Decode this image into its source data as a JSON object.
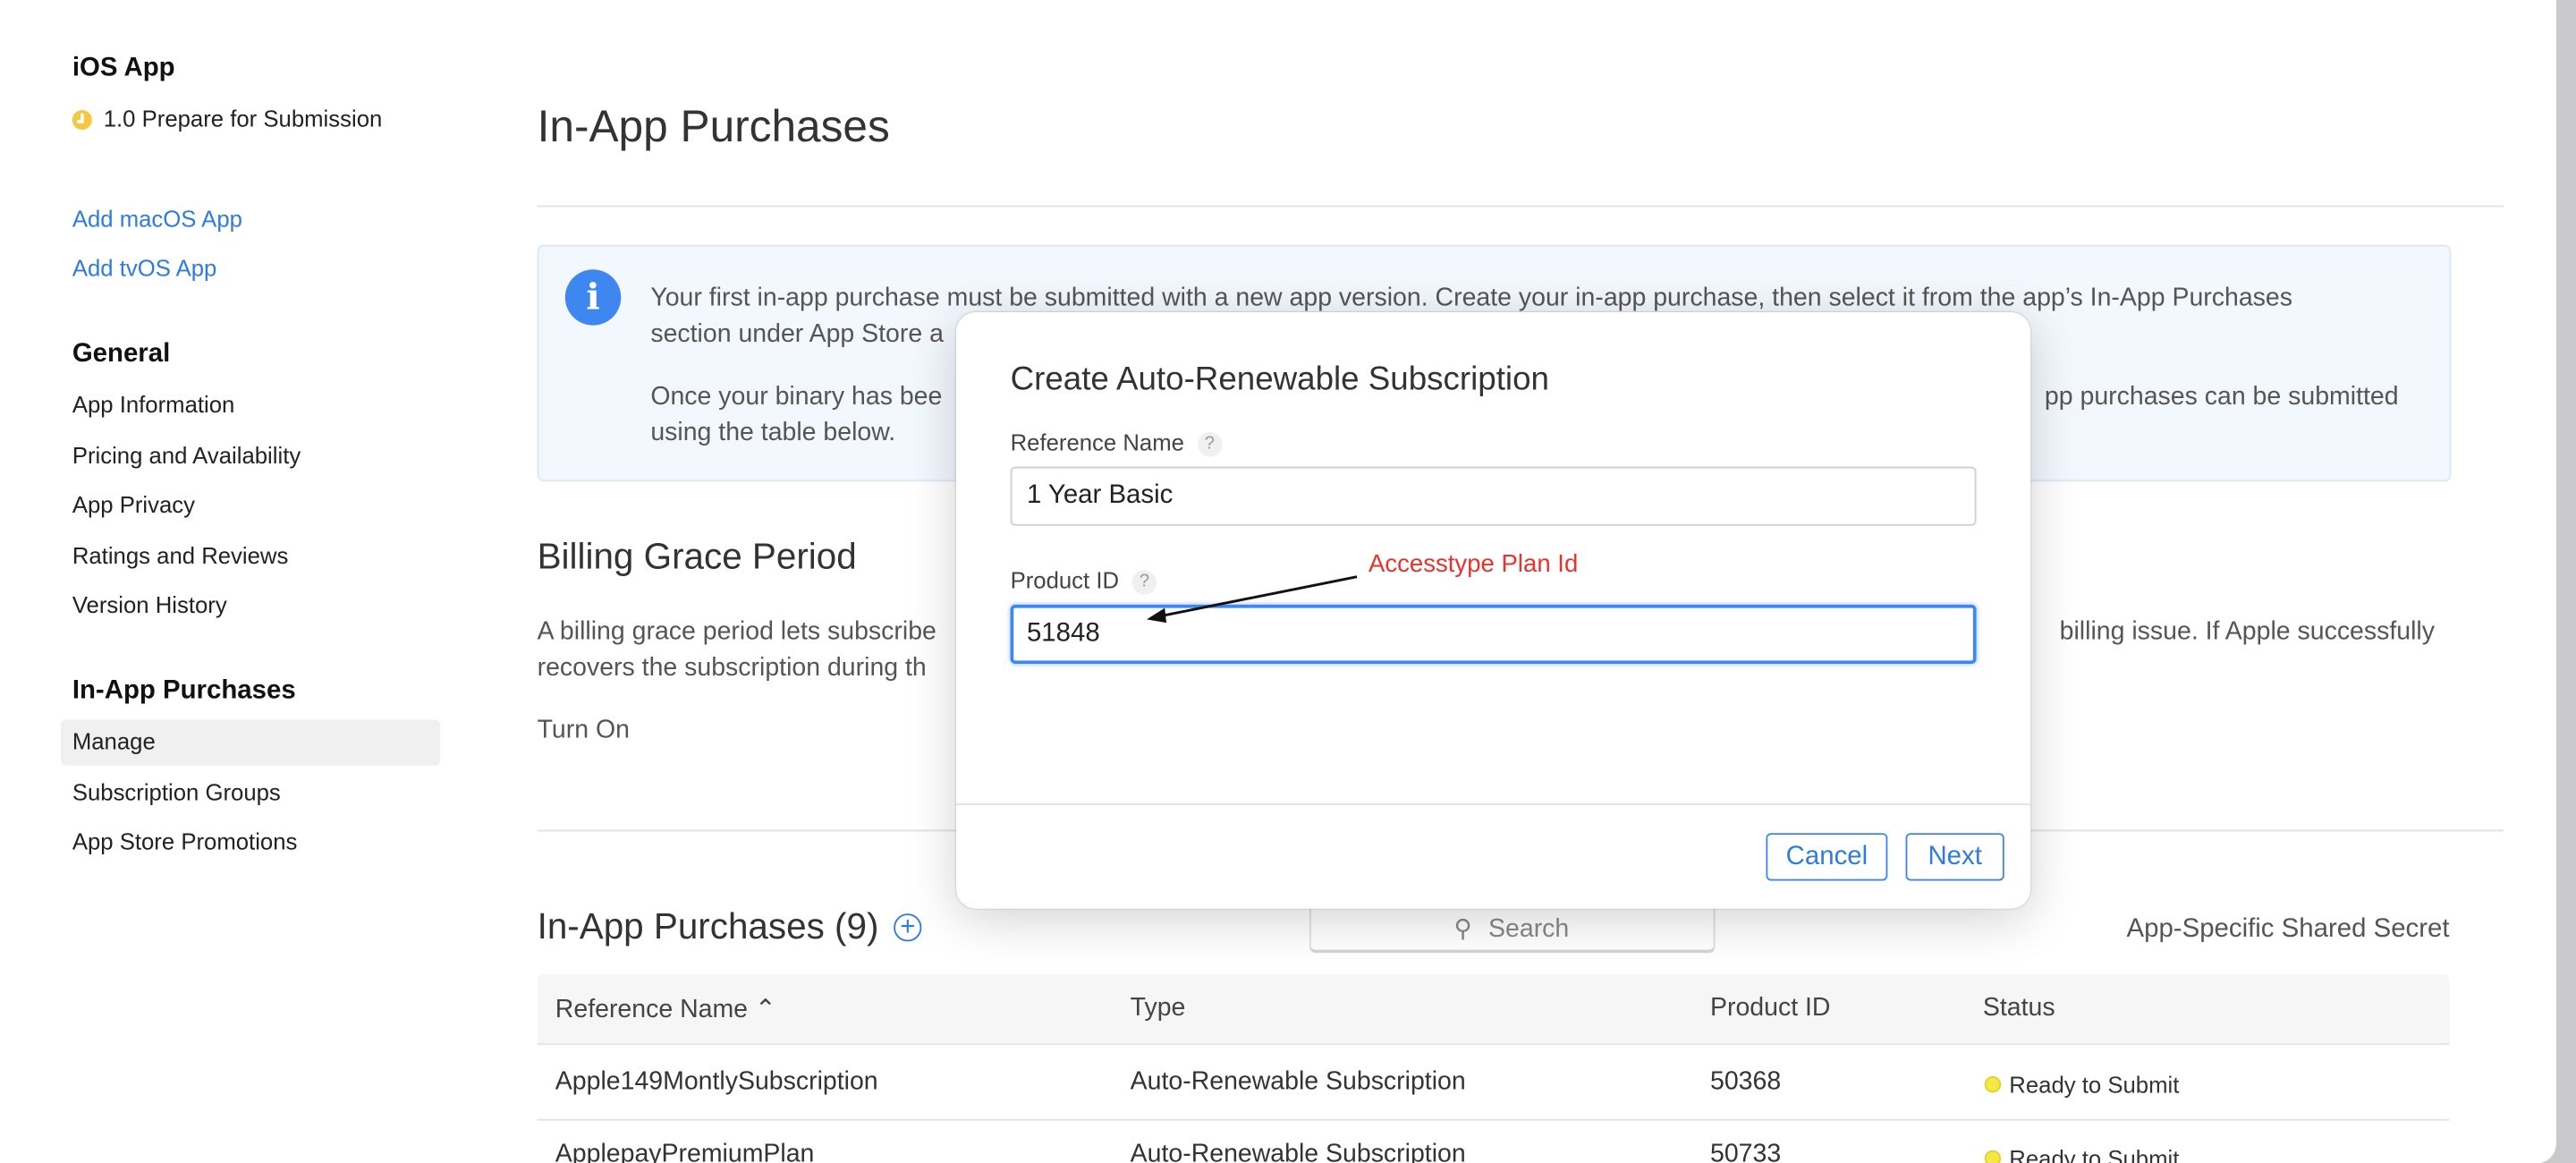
{
  "sidebar": {
    "app_title": "iOS App",
    "version_status": "1.0 Prepare for Submission",
    "add_links": [
      "Add macOS App",
      "Add tvOS App"
    ],
    "general_heading": "General",
    "general_items": [
      "App Information",
      "Pricing and Availability",
      "App Privacy",
      "Ratings and Reviews",
      "Version History"
    ],
    "iap_heading": "In-App Purchases",
    "iap_items": [
      "Manage",
      "Subscription Groups",
      "App Store Promotions"
    ],
    "selected_item": "Manage"
  },
  "main": {
    "title": "In-App Purchases",
    "info": {
      "line1": "Your first in-app purchase must be submitted with a new app version. Create your in-app purchase, then select it from the app’s In-App Purchases",
      "line2": "section under App Store a",
      "line3_left": "Once your binary has bee",
      "line3_right": "pp purchases can be submitted",
      "line4": "using the table below."
    },
    "billing": {
      "heading": "Billing Grace Period",
      "line1_left": "A billing grace period lets subscribe",
      "line1_right": "billing issue. If Apple successfully",
      "line2": "recovers the subscription during th",
      "turn_on": "Turn On"
    },
    "list": {
      "heading": "In-App Purchases (9)",
      "search_placeholder": "Search",
      "shared_secret": "App-Specific Shared Secret",
      "columns": [
        "Reference Name ⌃",
        "Type",
        "Product ID",
        "Status"
      ],
      "rows": [
        {
          "name": "Apple149MontlySubscription",
          "type": "Auto-Renewable Subscription",
          "product_id": "50368",
          "status": "Ready to Submit"
        },
        {
          "name": "ApplepayPremiumPlan",
          "type": "Auto-Renewable Subscription",
          "product_id": "50733",
          "status": "Ready to Submit"
        }
      ]
    }
  },
  "modal": {
    "title": "Create Auto-Renewable Subscription",
    "reference_label": "Reference Name",
    "reference_value": "1 Year Basic",
    "product_label": "Product ID",
    "product_value": "51848",
    "help": "?",
    "annotation": "Accesstype Plan Id",
    "cancel": "Cancel",
    "next": "Next"
  },
  "colors": {
    "accent": "#2f7be0",
    "annotation": "#e8332b",
    "status_ready": "#f4e842",
    "version_status": "#f5c842"
  }
}
